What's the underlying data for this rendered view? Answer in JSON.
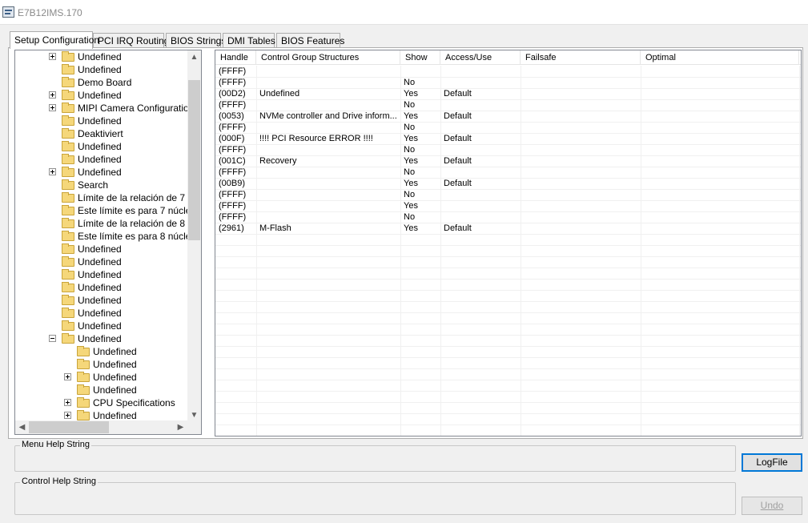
{
  "window": {
    "title": "E7B12IMS.170"
  },
  "tabs": [
    {
      "label": "Setup Configuration",
      "active": true
    },
    {
      "label": "PCI IRQ Routing",
      "active": false
    },
    {
      "label": "BIOS Strings",
      "active": false
    },
    {
      "label": "DMI Tables",
      "active": false
    },
    {
      "label": "BIOS Features",
      "active": false
    }
  ],
  "tree": {
    "items": [
      {
        "label": "Undefined",
        "level": 0,
        "expander": "plus"
      },
      {
        "label": "Undefined",
        "level": 0,
        "expander": "none"
      },
      {
        "label": "Demo Board",
        "level": 0,
        "expander": "none"
      },
      {
        "label": "Undefined",
        "level": 0,
        "expander": "plus"
      },
      {
        "label": "MIPI Camera Configuration",
        "level": 0,
        "expander": "plus"
      },
      {
        "label": "Undefined",
        "level": 0,
        "expander": "none"
      },
      {
        "label": "Deaktiviert",
        "level": 0,
        "expander": "none"
      },
      {
        "label": "Undefined",
        "level": 0,
        "expander": "none"
      },
      {
        "label": "Undefined",
        "level": 0,
        "expander": "none"
      },
      {
        "label": "Undefined",
        "level": 0,
        "expander": "plus"
      },
      {
        "label": "Search",
        "level": 0,
        "expander": "none"
      },
      {
        "label": "Límite de la relación de 7 núc",
        "level": 0,
        "expander": "none"
      },
      {
        "label": "Este límite es para 7 núcleos",
        "level": 0,
        "expander": "none"
      },
      {
        "label": "Límite de la relación de 8 núc",
        "level": 0,
        "expander": "none"
      },
      {
        "label": "Este límite es para 8 núcleos",
        "level": 0,
        "expander": "none"
      },
      {
        "label": "Undefined",
        "level": 0,
        "expander": "none"
      },
      {
        "label": "Undefined",
        "level": 0,
        "expander": "none"
      },
      {
        "label": "Undefined",
        "level": 0,
        "expander": "none"
      },
      {
        "label": "Undefined",
        "level": 0,
        "expander": "none"
      },
      {
        "label": "Undefined",
        "level": 0,
        "expander": "none"
      },
      {
        "label": "Undefined",
        "level": 0,
        "expander": "none"
      },
      {
        "label": "Undefined",
        "level": 0,
        "expander": "none"
      },
      {
        "label": "Undefined",
        "level": 0,
        "expander": "minus"
      },
      {
        "label": "Undefined",
        "level": 1,
        "expander": "none"
      },
      {
        "label": "Undefined",
        "level": 1,
        "expander": "none"
      },
      {
        "label": "Undefined",
        "level": 1,
        "expander": "plus"
      },
      {
        "label": "Undefined",
        "level": 1,
        "expander": "none"
      },
      {
        "label": "CPU Specifications",
        "level": 1,
        "expander": "plus"
      },
      {
        "label": "Undefined",
        "level": 1,
        "expander": "plus"
      }
    ],
    "scroll_up_icon": "up-arrow",
    "scroll_down_icon": "down-arrow",
    "scroll_left_icon": "left-arrow",
    "scroll_right_icon": "right-arrow"
  },
  "table": {
    "columns": [
      "Handle",
      "Control Group Structures",
      "Show",
      "Access/Use",
      "Failsafe",
      "Optimal"
    ],
    "rows": [
      [
        "(FFFF)",
        "",
        "",
        "",
        "",
        ""
      ],
      [
        "(FFFF)",
        "",
        "No",
        "",
        "",
        ""
      ],
      [
        "(00D2)",
        "Undefined",
        "Yes",
        "Default",
        "",
        ""
      ],
      [
        "(FFFF)",
        "",
        "No",
        "",
        "",
        ""
      ],
      [
        "(0053)",
        "NVMe controller and Drive inform...",
        "Yes",
        "Default",
        "",
        ""
      ],
      [
        "(FFFF)",
        "",
        "No",
        "",
        "",
        ""
      ],
      [
        "(000F)",
        "!!!! PCI Resource ERROR !!!!",
        "Yes",
        "Default",
        "",
        ""
      ],
      [
        "(FFFF)",
        "",
        "No",
        "",
        "",
        ""
      ],
      [
        "(001C)",
        "Recovery",
        "Yes",
        "Default",
        "",
        ""
      ],
      [
        "(FFFF)",
        "",
        "No",
        "",
        "",
        ""
      ],
      [
        "(00B9)",
        "",
        "Yes",
        "Default",
        "",
        ""
      ],
      [
        "(FFFF)",
        "",
        "No",
        "",
        "",
        ""
      ],
      [
        "(FFFF)",
        "",
        "Yes",
        "",
        "",
        ""
      ],
      [
        "(FFFF)",
        "",
        "No",
        "",
        "",
        ""
      ],
      [
        "(2961)",
        "M-Flash",
        "Yes",
        "Default",
        "",
        ""
      ]
    ]
  },
  "menu_help": {
    "legend": "Menu Help String"
  },
  "control_help": {
    "legend": "Control Help String"
  },
  "buttons": {
    "logfile": "LogFile",
    "undo": "Undo"
  }
}
